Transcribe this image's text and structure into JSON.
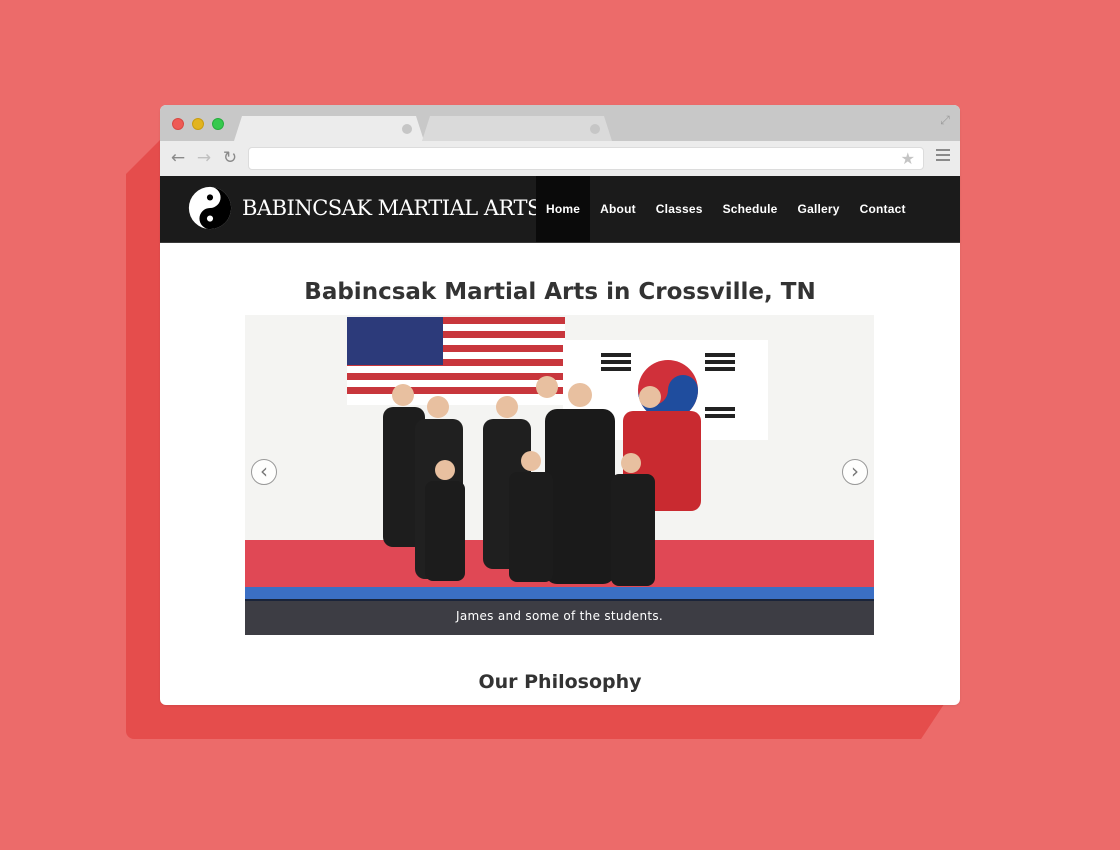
{
  "site": {
    "brand": "BABINCSAK MARTIAL ARTS",
    "nav": [
      {
        "label": "Home",
        "active": true
      },
      {
        "label": "About",
        "active": false
      },
      {
        "label": "Classes",
        "active": false
      },
      {
        "label": "Schedule",
        "active": false
      },
      {
        "label": "Gallery",
        "active": false
      },
      {
        "label": "Contact",
        "active": false
      }
    ]
  },
  "main": {
    "title": "Babincsak Martial Arts in Crossville, TN",
    "slider": {
      "caption": "James and some of the students.",
      "prev_glyph": "‹",
      "next_glyph": "›"
    },
    "section_heading": "Our Philosophy"
  },
  "browser": {
    "url": "",
    "icons": [
      "back-icon",
      "forward-icon",
      "reload-icon",
      "star-icon",
      "menu-icon",
      "expand-icon"
    ]
  },
  "colors": {
    "background": "#ec6b6a",
    "navbar": "#1b1b1b",
    "nav_active": "#0a0a0a"
  }
}
